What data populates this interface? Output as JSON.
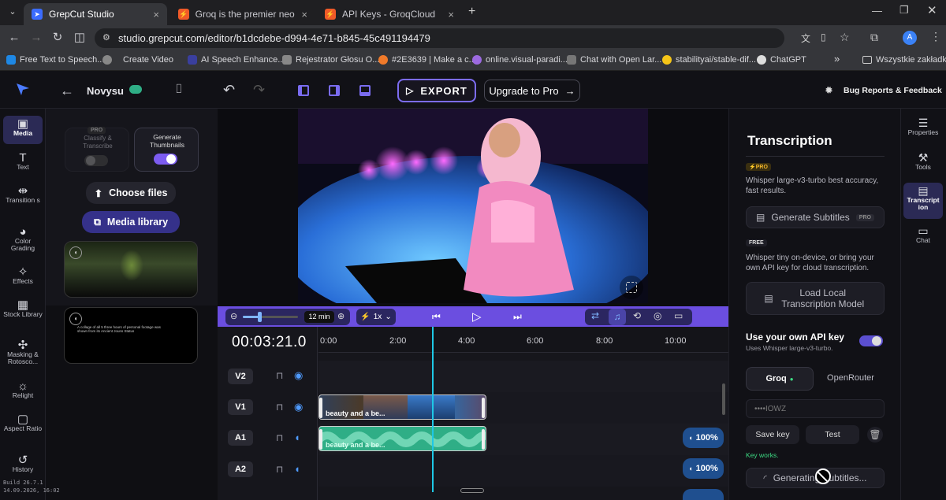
{
  "browser": {
    "tabs": [
      {
        "title": "GrepCut Studio",
        "active": true,
        "fav_color": "#3b6cff"
      },
      {
        "title": "Groq is the premier neocloud f...",
        "active": false,
        "fav_color": "#f05a28"
      },
      {
        "title": "API Keys - GroqCloud",
        "active": false,
        "fav_color": "#f05a28"
      }
    ],
    "new_tab": "+",
    "url": "studio.grepcut.com/editor/b1dcdebe-d994-4e71-b845-45c491194479",
    "profile_initial": "A",
    "bookmarks": [
      "Free Text to Speech...",
      "Create Video",
      "AI Speech Enhance...",
      "Rejestrator Głosu O...",
      "#2E3639 | Make a c...",
      "online.visual-paradi...",
      "Chat with Open Lar...",
      "stabilityai/stable-dif...",
      "ChatGPT"
    ],
    "bookmarks_more": "»",
    "bookmarks_folder": "Wszystkie zakładki"
  },
  "app": {
    "project_name": "Novysu",
    "export_label": "EXPORT",
    "upgrade_label": "Upgrade to Pro",
    "bug_report_label": "Bug Reports & Feedback"
  },
  "left_nav": [
    {
      "label": "Media",
      "icon": "media-icon",
      "glyph": "▣",
      "active": true
    },
    {
      "label": "Text",
      "icon": "text-icon",
      "glyph": "T",
      "active": false
    },
    {
      "label": "Transition s",
      "icon": "transitions-icon",
      "glyph": "⇹",
      "active": false
    },
    {
      "label": "Color Grading",
      "icon": "palette-icon",
      "glyph": "◕",
      "active": false
    },
    {
      "label": "Effects",
      "icon": "wand-icon",
      "glyph": "✧",
      "active": false
    },
    {
      "label": "Stock Library",
      "icon": "grid-icon",
      "glyph": "▦",
      "active": false
    },
    {
      "label": "Masking & Rotosco...",
      "icon": "puzzle-icon",
      "glyph": "✣",
      "active": false
    },
    {
      "label": "Relight",
      "icon": "sun-icon",
      "glyph": "☼",
      "active": false
    },
    {
      "label": "Aspect Ratio",
      "icon": "aspect-icon",
      "glyph": "▢",
      "active": false
    },
    {
      "label": "History",
      "icon": "history-icon",
      "glyph": "↺",
      "active": false
    }
  ],
  "build_info": {
    "version": "Build 26.7.1",
    "date": "14.09.2026, 16:02"
  },
  "media_panel": {
    "pro_badge": "PRO",
    "classify_label": "Classify & Transcribe",
    "thumbnails_label": "Generate Thumbnails",
    "thumbnails_on": true,
    "choose_files": "Choose files",
    "media_library": "Media library",
    "clip2_caption": "A collage of all 5 three hours of personal footage was shown from its Ancient Jouns Status"
  },
  "timeline": {
    "timecode": "00:03:21.0",
    "zoom_label": "12 min",
    "zoom_level": 0.3,
    "speed_label": "1x",
    "ticks": [
      "0:00",
      "2:00",
      "4:00",
      "6:00",
      "8:00",
      "10:00"
    ],
    "tracks": [
      "V2",
      "V1",
      "A1",
      "A2"
    ],
    "clip_label_v1": "beauty and a be...",
    "clip_label_a1": "beauty and a be...",
    "volume_a1": "100%",
    "volume_a2": "100%"
  },
  "transcription": {
    "title": "Transcription",
    "pro_badge": "PRO",
    "pro_desc": "Whisper large-v3-turbo best accuracy, fast results.",
    "generate_subtitles": "Generate Subtitles",
    "generate_pro_badge": "PRO",
    "free_badge": "FREE",
    "free_desc": "Whisper tiny on-device, or bring your own API key for cloud transcription.",
    "load_local": "Load Local Transcription Model",
    "own_key_title": "Use your own API key",
    "own_key_sub": "Uses Whisper large-v3-turbo.",
    "own_key_on": true,
    "provider_groq": "Groq",
    "provider_openrouter": "OpenRouter",
    "api_key_masked": "••••IOWZ",
    "save_key": "Save key",
    "test": "Test",
    "key_status": "Key works.",
    "generating": "Generating Subtitles..."
  },
  "right_nav": [
    {
      "label": "Properties",
      "icon": "sliders-icon",
      "glyph": "☰",
      "active": false
    },
    {
      "label": "Tools",
      "icon": "wrench-icon",
      "glyph": "⚒",
      "active": false
    },
    {
      "label": "Transcript ion",
      "icon": "captions-icon",
      "glyph": "▤",
      "active": true
    },
    {
      "label": "Chat",
      "icon": "chat-icon",
      "glyph": "▭",
      "active": false
    }
  ],
  "colors": {
    "accent": "#6b4ee0",
    "playhead": "#1ec8e6",
    "audio_clip": "#2fae86",
    "key_ok": "#3ddc84"
  }
}
